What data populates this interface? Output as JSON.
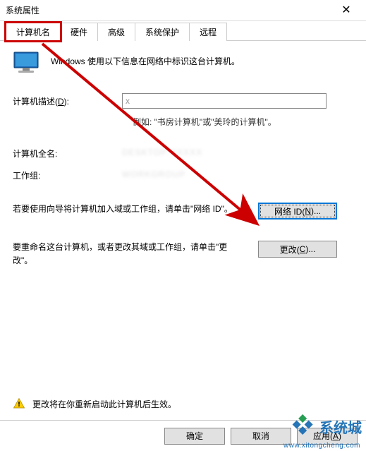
{
  "titlebar": {
    "title": "系统属性"
  },
  "tabs": {
    "items": [
      {
        "label": "计算机名"
      },
      {
        "label": "硬件"
      },
      {
        "label": "高级"
      },
      {
        "label": "系统保护"
      },
      {
        "label": "远程"
      }
    ]
  },
  "intro": "Windows 使用以下信息在网络中标识这台计算机。",
  "description": {
    "label": "计算机描述(D):",
    "value": "x",
    "example": "例如: \"书房计算机\"或\"美玲的计算机\"。"
  },
  "fullname": {
    "label": "计算机全名:",
    "value": "DESKTOP-XXXXX"
  },
  "workgroup": {
    "label": "工作组:",
    "value": "WORKGROUP"
  },
  "netid": {
    "text": "若要使用向导将计算机加入域或工作组，请单击\"网络 ID\"。",
    "button": "网络 ID(N)..."
  },
  "change": {
    "text": "要重命名这台计算机，或者更改其域或工作组，请单击\"更改\"。",
    "button": "更改(C)..."
  },
  "warning": "更改将在你重新启动此计算机后生效。",
  "buttons": {
    "ok": "确定",
    "cancel": "取消",
    "apply": "应用(A)"
  },
  "watermark": {
    "brand": "系统城",
    "url": "www.xitongcheng.com"
  },
  "colors": {
    "highlight": "#c00",
    "accent": "#0078d7",
    "wm": "#1b6fb5"
  }
}
